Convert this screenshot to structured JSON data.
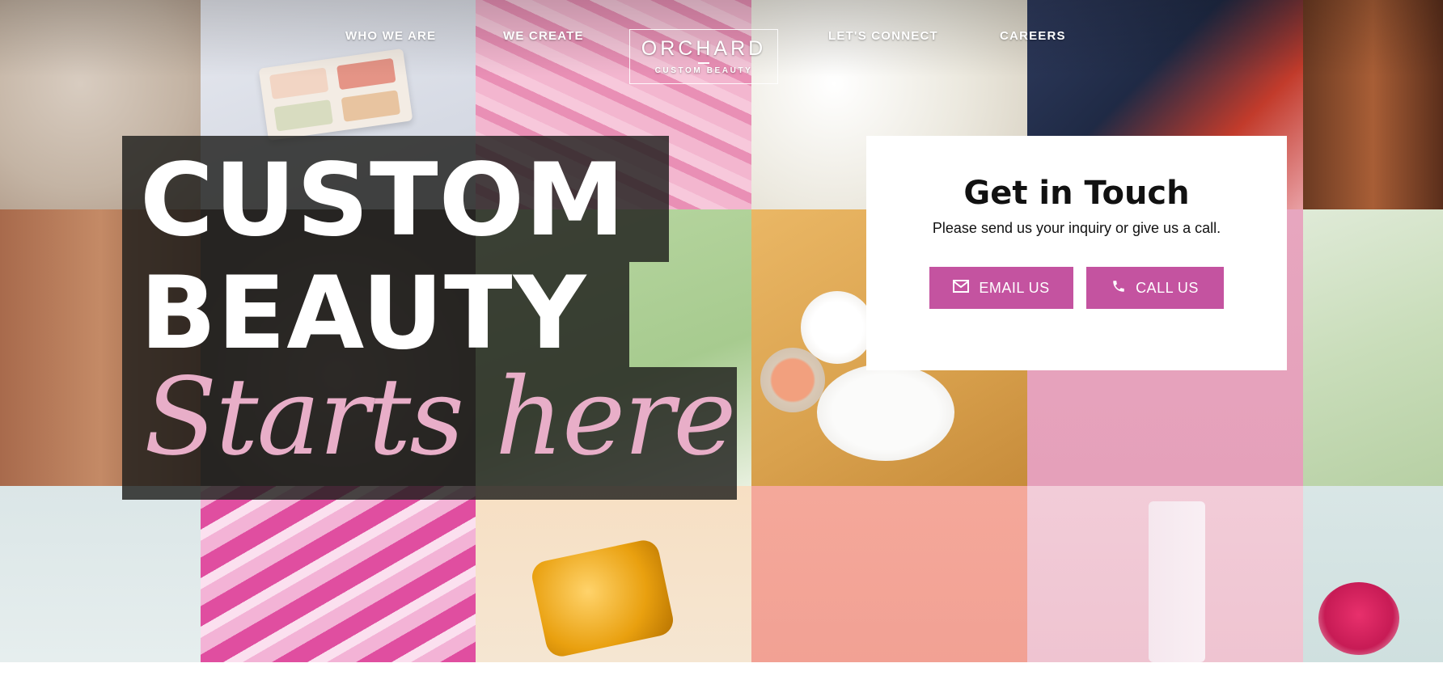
{
  "nav": {
    "items": [
      "WHO WE ARE",
      "WE CREATE",
      "LET'S CONNECT",
      "CAREERS"
    ],
    "logo": {
      "name": "ORCHARD",
      "tagline": "CUSTOM BEAUTY"
    }
  },
  "hero": {
    "line1": "CUSTOM",
    "line2": "BEAUTY",
    "script": "Starts here"
  },
  "contact": {
    "title": "Get in Touch",
    "subtitle": "Please send us your inquiry or give us a call.",
    "email_label": "EMAIL US",
    "call_label": "CALL US",
    "email_icon": "envelope-icon",
    "call_icon": "phone-icon"
  },
  "colors": {
    "accent": "#c453a0",
    "script_pink": "#e8aec8",
    "overlay": "#1e1e1c"
  }
}
